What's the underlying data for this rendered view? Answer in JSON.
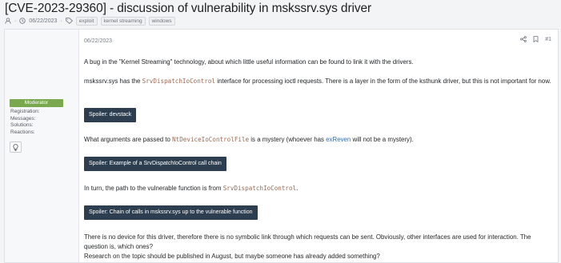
{
  "thread": {
    "title": "[CVE-2023-29360] - discussion of vulnerability in mskssrv.sys driver",
    "date": "06/22/2023",
    "tags": [
      "exploit",
      "kernel streaming",
      "windows"
    ]
  },
  "user": {
    "role": "Moderator",
    "labels": [
      "Registration:",
      "Messages:",
      "Solutions:",
      "Reactions:"
    ],
    "icon": "lightbulb-icon"
  },
  "post": {
    "date": "06/22/2023",
    "number": "#1",
    "actions": [
      "share-icon",
      "bookmark-icon"
    ],
    "p1": "A bug in the \"Kernel Streaming\" technology, about which little useful information can be found to link it with the drivers.",
    "p2_before": "mskssrv.sys has the ",
    "p2_code": "SrvDispatchIoControl",
    "p2_after": " interface for processing ioctl requests. There is a layer in the form of the ksthunk driver, but this is not important for now.",
    "spoiler1": "Spoiler: devstack",
    "p3_before": "What arguments are passed to ",
    "p3_code": "NtDeviceIoControlFile",
    "p3_mid": " is a mystery (whoever has ",
    "p3_link": "exReven",
    "p3_after": " will not be a mystery).",
    "spoiler2": "Spoiler: Example of a SrvDispatchIoControl call chain",
    "p4_before": "In turn, the path to the vulnerable function is from ",
    "p4_code": "SrvDispatchIoControl",
    "p4_after": ".",
    "spoiler3": "Spoiler: Chain of calls in mskssrv.sys up to the vulnerable function",
    "p5": "There is no device for this driver, therefore there is no symbolic link through which requests can be sent. Obviously, other interfaces are used for interaction. The question is, which ones?",
    "p6": "Research on the topic should be published in August, but maybe someone has already added something?"
  }
}
